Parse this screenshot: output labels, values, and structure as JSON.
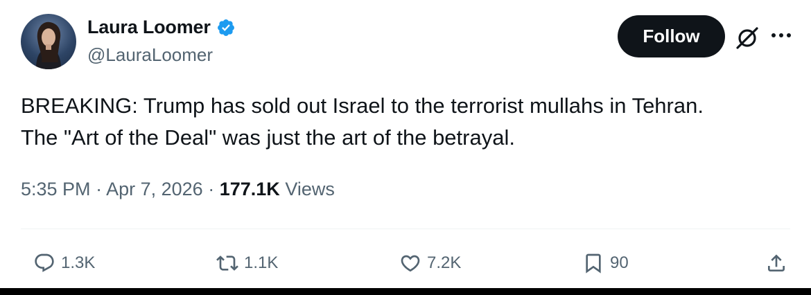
{
  "author": {
    "display_name": "Laura Loomer",
    "handle": "@LauraLoomer",
    "verified": true
  },
  "follow_label": "Follow",
  "tweet": {
    "lines": [
      "BREAKING: Trump has sold out Israel to the terrorist mullahs in Tehran.",
      "The \"Art of the Deal\" was just the art of the betrayal."
    ]
  },
  "meta": {
    "time": "5:35 PM",
    "separator": "·",
    "date": "Apr 7, 2026",
    "views_count": "177.1K",
    "views_label": "Views"
  },
  "actions": {
    "replies": "1.3K",
    "reposts": "1.1K",
    "likes": "7.2K",
    "bookmarks": "90"
  },
  "icons": {
    "verified": "verified-badge-icon",
    "grok": "grok-icon",
    "more": "more-options-icon",
    "reply": "reply-icon",
    "repost": "repost-icon",
    "like": "heart-icon",
    "bookmark": "bookmark-icon",
    "share": "share-icon"
  },
  "colors": {
    "verified_blue": "#1d9bf0",
    "text_primary": "#0f1419",
    "text_secondary": "#536471",
    "follow_button_bg": "#0f1419"
  }
}
